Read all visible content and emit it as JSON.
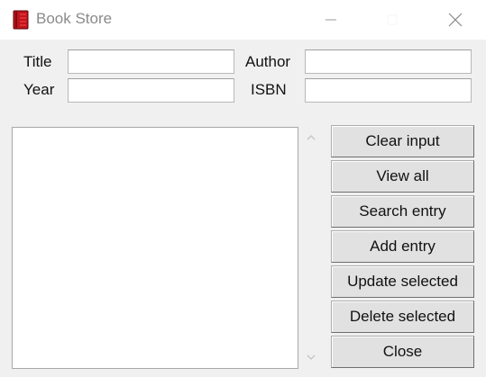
{
  "window": {
    "title": "Book Store",
    "icon": "book-icon"
  },
  "form": {
    "title_label": "Title",
    "author_label": "Author",
    "year_label": "Year",
    "isbn_label": "ISBN",
    "title_value": "",
    "author_value": "",
    "year_value": "",
    "isbn_value": ""
  },
  "listbox": {
    "items": []
  },
  "buttons": {
    "clear_input": "Clear input",
    "view_all": "View all",
    "search_entry": "Search entry",
    "add_entry": "Add entry",
    "update_selected": "Update selected",
    "delete_selected": "Delete selected",
    "close": "Close"
  },
  "colors": {
    "window_bg": "#f0f0f0",
    "titlebar_bg": "#ffffff",
    "button_bg": "#e1e1e1",
    "icon_red": "#c0141c"
  }
}
